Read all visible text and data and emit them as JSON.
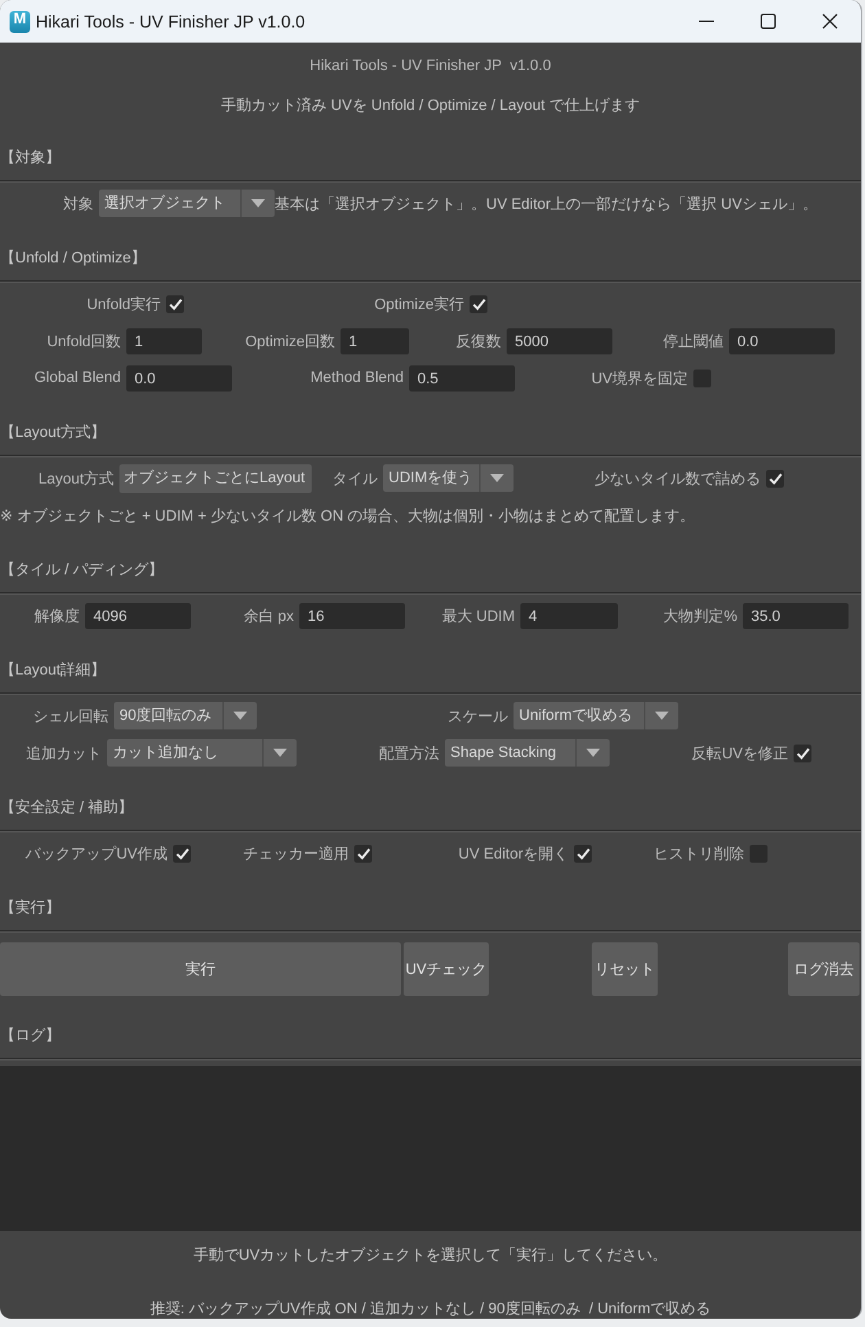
{
  "window": {
    "app_icon": "M",
    "title": "Hikari Tools - UV Finisher JP v1.0.0"
  },
  "header": {
    "title": "Hikari Tools - UV Finisher JP  v1.0.0",
    "subtitle": "手動カット済み UVを Unfold / Optimize / Layout で仕上げます"
  },
  "sections": [
    {
      "kind": "form",
      "title": "【対象】",
      "rows": [
        [
          {
            "kind": "dropdown",
            "label": "対象",
            "value": "選択オブジェクト"
          },
          {
            "kind": "note",
            "text": "基本は「選択オブジェクト」。UV Editor上の一部だけなら「選択 UVシェル」。"
          }
        ]
      ]
    },
    {
      "kind": "form",
      "title": "【Unfold / Optimize】",
      "rows": [
        [
          {
            "kind": "checkbox",
            "label": "Unfold実行",
            "checked": true
          },
          {
            "kind": "checkbox",
            "label": "Optimize実行",
            "checked": true
          }
        ],
        [
          {
            "kind": "field",
            "label": "Unfold回数",
            "value": "1"
          },
          {
            "kind": "field",
            "label": "Optimize回数",
            "value": "1"
          },
          {
            "kind": "field",
            "label": "反復数",
            "value": "5000"
          },
          {
            "kind": "field",
            "label": "停止閾値",
            "value": "0.0"
          }
        ],
        [
          {
            "kind": "field",
            "label": "Global Blend",
            "value": "0.0"
          },
          {
            "kind": "field",
            "label": "Method Blend",
            "value": "0.5"
          },
          {
            "kind": "checkbox",
            "label": "UV境界を固定",
            "checked": false
          }
        ]
      ]
    },
    {
      "kind": "form",
      "title": "【Layout方式】",
      "rows": [
        [
          {
            "kind": "display",
            "label": "Layout方式",
            "value": "オブジェクトごとにLayout"
          },
          {
            "kind": "dropdown",
            "label": "タイル",
            "value": "UDIMを使う"
          },
          {
            "kind": "checkbox",
            "label": "少ないタイル数で詰める",
            "checked": true
          }
        ],
        [
          {
            "kind": "note",
            "text": "※ オブジェクトごと + UDIM + 少ないタイル数 ON の場合、大物は個別・小物はまとめて配置します。"
          }
        ]
      ]
    },
    {
      "kind": "form",
      "title": "【タイル / パディング】",
      "rows": [
        [
          {
            "kind": "field",
            "label": "解像度",
            "value": "4096"
          },
          {
            "kind": "field",
            "label": "余白 px",
            "value": "16"
          },
          {
            "kind": "field",
            "label": "最大 UDIM",
            "value": "4"
          },
          {
            "kind": "field",
            "label": "大物判定%",
            "value": "35.0"
          }
        ]
      ]
    },
    {
      "kind": "form",
      "title": "【Layout詳細】",
      "rows": [
        [
          {
            "kind": "dropdown",
            "label": "シェル回転",
            "value": "90度回転のみ"
          },
          {
            "kind": "dropdown",
            "label": "スケール",
            "value": "Uniformで収める"
          }
        ],
        [
          {
            "kind": "dropdown",
            "label": "追加カット",
            "value": "カット追加なし"
          },
          {
            "kind": "dropdown",
            "label": "配置方法",
            "value": "Shape Stacking"
          },
          {
            "kind": "checkbox",
            "label": "反転UVを修正",
            "checked": true
          }
        ]
      ]
    },
    {
      "kind": "form",
      "title": "【安全設定 / 補助】",
      "rows": [
        [
          {
            "kind": "checkbox",
            "label": "バックアップUV作成",
            "checked": true
          },
          {
            "kind": "checkbox",
            "label": "チェッカー適用",
            "checked": true
          },
          {
            "kind": "checkbox",
            "label": "UV Editorを開く",
            "checked": true
          },
          {
            "kind": "checkbox",
            "label": "ヒストリ削除",
            "checked": false
          }
        ]
      ]
    },
    {
      "kind": "actions",
      "title": "【実行】",
      "buttons": [
        {
          "label": "実行"
        },
        {
          "label": "UVチェック"
        },
        {
          "label": "リセット"
        },
        {
          "label": "ログ消去"
        }
      ]
    },
    {
      "kind": "log",
      "title": "【ログ】"
    }
  ],
  "footer": {
    "message": "手動でUVカットしたオブジェクトを選択して「実行」してください。",
    "recommendation": "推奨: バックアップUV作成 ON / 追加カットなし / 90度回転のみ  / Uniformで収める"
  }
}
